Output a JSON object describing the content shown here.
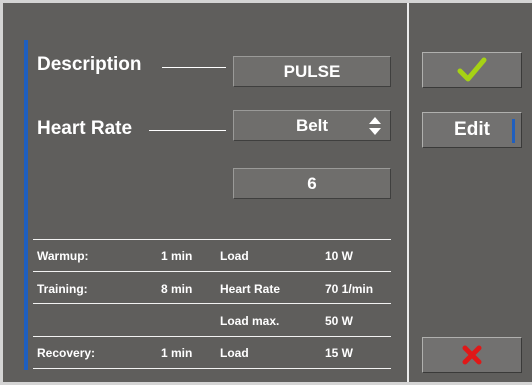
{
  "form": {
    "description_label": "Description",
    "description_value": "PULSE",
    "heart_rate_label": "Heart Rate",
    "heart_rate_value": "Belt",
    "number_value": "6"
  },
  "summary": {
    "rows": [
      {
        "phase": "Warmup:",
        "duration": "1 min",
        "param": "Load",
        "value": "10 W"
      },
      {
        "phase": "Training:",
        "duration": "8 min",
        "param": "Heart Rate",
        "value": "70 1/min"
      },
      {
        "phase": "",
        "duration": "",
        "param": "Load max.",
        "value": "50 W"
      },
      {
        "phase": "Recovery:",
        "duration": "1 min",
        "param": "Load",
        "value": "15 W"
      }
    ]
  },
  "side_panel": {
    "edit_label": "Edit",
    "confirm_icon": "checkmark-icon",
    "cancel_icon": "x-icon"
  },
  "colors": {
    "background": "#5f5e5c",
    "accent": "#1f5fbf",
    "confirm": "#a6d214",
    "cancel": "#e01818"
  }
}
